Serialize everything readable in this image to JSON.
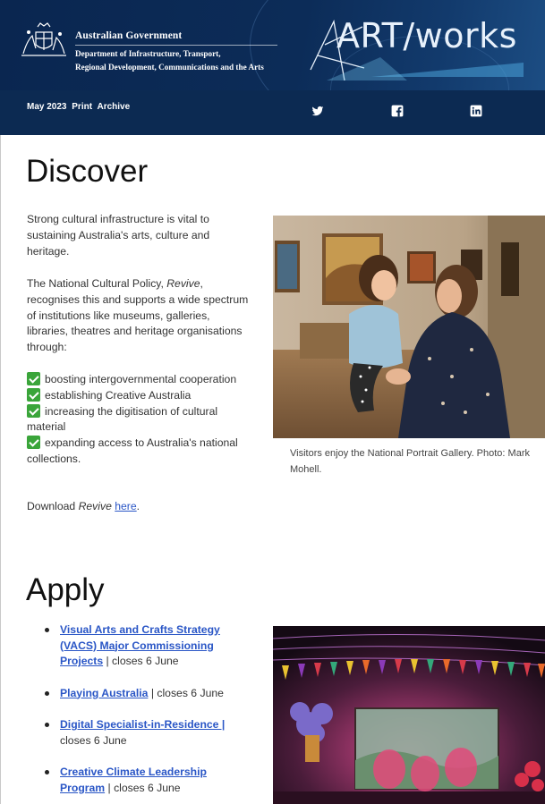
{
  "header": {
    "gov_name": "Australian Government",
    "dept_line1": "Department of Infrastructure, Transport,",
    "dept_line2": "Regional Development, Communications and the Arts",
    "logo_text": "ART/works",
    "nav": [
      "May 2023",
      "Print",
      "Archive"
    ],
    "social": [
      {
        "name": "twitter",
        "icon": "twitter-icon"
      },
      {
        "name": "facebook",
        "icon": "facebook-icon"
      },
      {
        "name": "linkedin",
        "icon": "linkedin-icon"
      }
    ]
  },
  "discover": {
    "heading": "Discover",
    "p1": "Strong cultural infrastructure is vital to sustaining Australia's arts, culture and heritage.",
    "p2_before": "The National Cultural Policy, ",
    "p2_italic": "Revive",
    "p2_after": ", recognises this and supports a wide spectrum of institutions like museums, galleries, libraries, theatres and heritage organisations through:",
    "checklist": [
      "boosting intergovernmental cooperation",
      "establishing Creative Australia",
      "increasing the digitisation of cultural material",
      "expanding access to Australia's national collections."
    ],
    "download_before": "Download ",
    "download_italic": "Revive",
    "download_link": "here",
    "download_after": ".",
    "caption": "Visitors enjoy the National Portrait Gallery. Photo: Mark Mohell."
  },
  "apply": {
    "heading": "Apply",
    "items": [
      {
        "link": "Visual Arts and Crafts Strategy (VACS) Major Commissioning Projects",
        "suffix": " | closes 6 June"
      },
      {
        "link": "Playing Australia",
        "suffix": " | closes 6 June"
      },
      {
        "link": "Digital Specialist-in-Residence |",
        "suffix": " closes 6 June"
      },
      {
        "link": "Creative Climate Leadership Program",
        "suffix": " | closes 6 June"
      }
    ]
  },
  "colors": {
    "header_bg": "#0c2a52",
    "link": "#2a56c6",
    "check_green": "#3aa53a"
  }
}
